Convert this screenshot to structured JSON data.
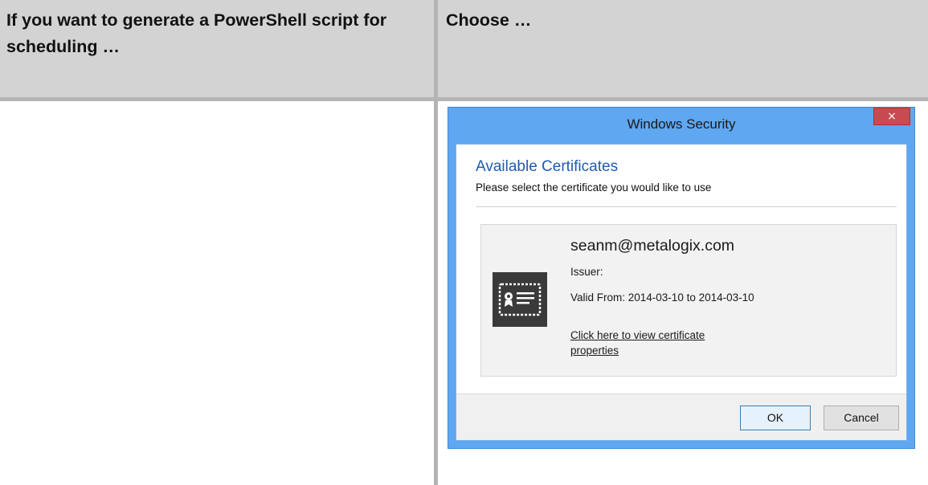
{
  "table": {
    "header_col1": "If you want to generate a PowerShell script for scheduling …",
    "header_col2": "Choose …"
  },
  "dialog": {
    "title": "Windows Security",
    "close_glyph": "×",
    "heading": "Available Certificates",
    "subheading": "Please select the certificate you would like to use",
    "certificate": {
      "email": "seanm@metalogix.com",
      "issuer": "Issuer:",
      "valid": "Valid From: 2014-03-10 to 2014-03-10",
      "link": "Click here to view certificate properties"
    },
    "ok_label": "OK",
    "cancel_label": "Cancel"
  },
  "colors": {
    "titlebar": "#5fa7f0",
    "close": "#c74b50",
    "heading": "#1f5bb0",
    "header_bg": "#d3d3d3"
  },
  "icons": [
    "close-icon",
    "certificate-icon"
  ]
}
